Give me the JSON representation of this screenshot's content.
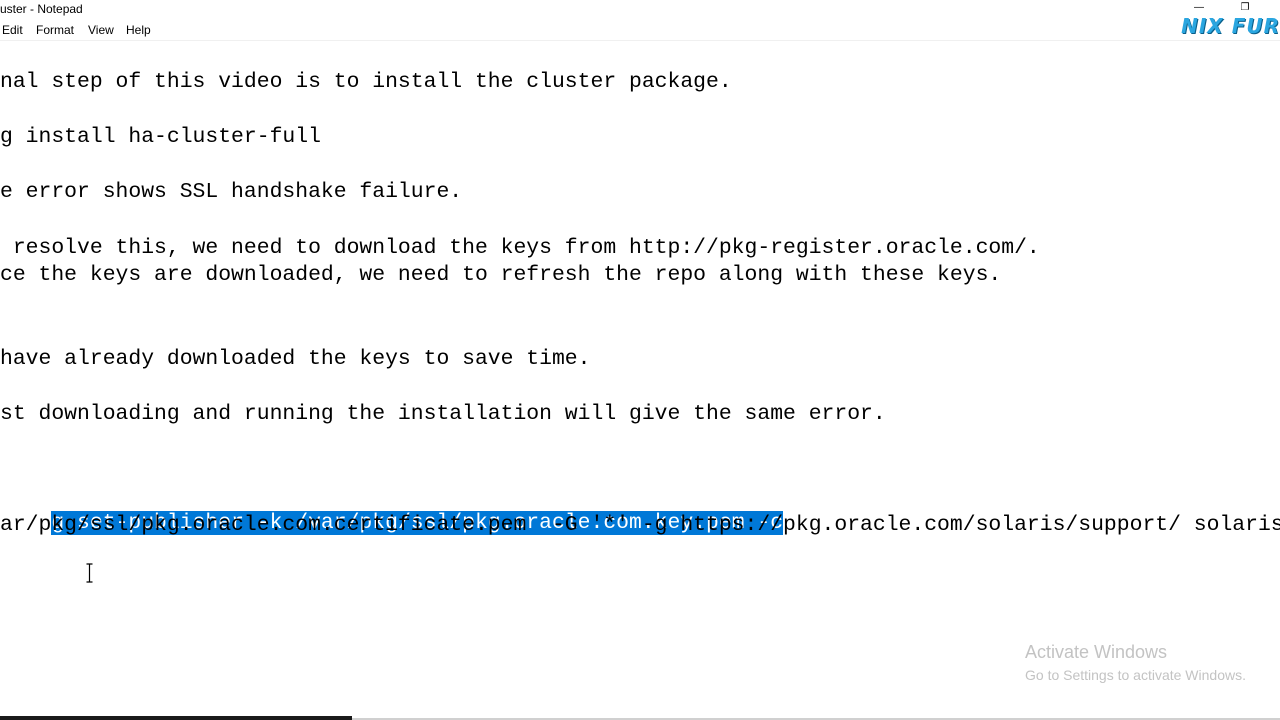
{
  "window": {
    "title": "uster - Notepad",
    "minimize_glyph": "—",
    "maximize_glyph": "❐"
  },
  "menu": {
    "items": [
      "Edit",
      "Format",
      "View",
      "Help"
    ]
  },
  "logo_text": "NIX FUR",
  "editor": {
    "lines": [
      "nal step of this video is to install the cluster package.",
      "g install ha-cluster-full",
      "e error shows SSL handshake failure.",
      " resolve this, we need to download the keys from http://pkg-register.oracle.com/.",
      "ce the keys are downloaded, we need to refresh the repo along with these keys.",
      "have already downloaded the keys to save time.",
      "st downloading and running the installation will give the same error.",
      "g set-publisher -k /var/pkg/ssl/pkg.oracle.com.key.pem -c",
      "ar/pkg/ssl/pkg.oracle.com.certificate.pem  -G '*' -g https://pkg.oracle.com/solaris/support/ solaris"
    ],
    "selected_line_index": 7
  },
  "watermark": {
    "title": "Activate Windows",
    "subtitle": "Go to Settings to activate Windows."
  },
  "colors": {
    "selection": "#0078d7",
    "logo": "#2aa6e0",
    "watermark": "#c3c3c3"
  }
}
